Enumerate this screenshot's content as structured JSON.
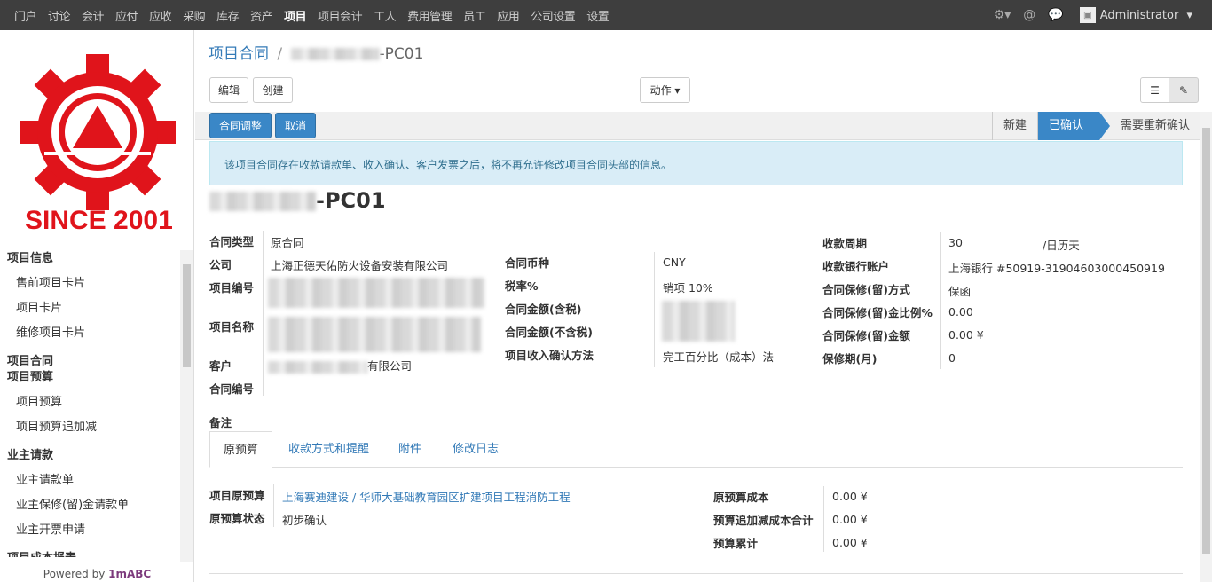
{
  "topmenu": [
    "门户",
    "讨论",
    "会计",
    "应付",
    "应收",
    "采购",
    "库存",
    "资产",
    "项目",
    "项目会计",
    "工人",
    "费用管理",
    "员工",
    "应用",
    "公司设置",
    "设置"
  ],
  "topmenu_active": "项目",
  "user": "Administrator",
  "logo_text": "SINCE 2001",
  "sidebar": {
    "sections": [
      {
        "title": "项目信息",
        "items": [
          "售前项目卡片",
          "项目卡片",
          "维修项目卡片"
        ]
      },
      {
        "title": "项目合同",
        "items": []
      },
      {
        "title": "项目预算",
        "items": [
          "项目预算",
          "项目预算追加减"
        ]
      },
      {
        "title": "业主请款",
        "items": [
          "业主请款单",
          "业主保修(留)金请款单",
          "业主开票申请"
        ]
      },
      {
        "title": "项目成本报表",
        "items": []
      }
    ],
    "powered_prefix": "Powered by ",
    "powered_brand": "1mABC"
  },
  "breadcrumb": {
    "parent": "项目合同",
    "separator": "/",
    "current_suffix": "-PC01"
  },
  "buttons": {
    "edit": "编辑",
    "create": "创建",
    "action": "动作",
    "adjust": "合同调整",
    "cancel": "取消"
  },
  "stages": [
    "新建",
    "已确认",
    "需要重新确认"
  ],
  "stage_active": "已确认",
  "alert": "该项目合同存在收款请款单、收入确认、客户发票之后，将不再允许修改项目合同头部的信息。",
  "record_title_suffix": "-PC01",
  "form": {
    "col1": {
      "contract_type_label": "合同类型",
      "contract_type": "原合同",
      "company_label": "公司",
      "company": "上海正德天佑防火设备安装有限公司",
      "project_no_label": "项目编号",
      "project_name_label": "项目名称",
      "customer_label": "客户",
      "customer_suffix": "有限公司",
      "contract_no_label": "合同编号"
    },
    "col2": {
      "currency_label": "合同币种",
      "currency": "CNY",
      "tax_label": "税率%",
      "tax": "销项 10%",
      "amount_tax_label": "合同金额(含税)",
      "amount_notax_label": "合同金额(不含税)",
      "method_label": "项目收入确认方法",
      "method": "完工百分比（成本）法"
    },
    "col3": {
      "period_label": "收款周期",
      "period": "30",
      "period_unit": "/日历天",
      "bank_label": "收款银行账户",
      "bank": "上海银行 #50919-31904603000450919",
      "retention_method_label": "合同保修(留)方式",
      "retention_method": "保函",
      "retention_ratio_label": "合同保修(留)金比例%",
      "retention_ratio": "0.00",
      "retention_amount_label": "合同保修(留)金额",
      "retention_amount": "0.00 ¥",
      "warranty_label": "保修期(月)",
      "warranty": "0"
    },
    "notes_label": "备注"
  },
  "tabs": [
    "原预算",
    "收款方式和提醒",
    "附件",
    "修改日志"
  ],
  "tab_active": "原预算",
  "budget": {
    "orig_label": "项目原预算",
    "orig": "上海赛迪建设 / 华师大基础教育园区扩建项目工程消防工程",
    "status_label": "原预算状态",
    "status": "初步确认",
    "cost_label": "原预算成本",
    "cost": "0.00 ¥",
    "add_label": "预算追加减成本合计",
    "add": "0.00 ¥",
    "total_label": "预算累计",
    "total": "0.00 ¥"
  },
  "colors": {
    "topbar": "#3e3e3e",
    "primary": "#3a87c7",
    "link": "#337ab7",
    "logo": "#e0141b",
    "alert_bg": "#d9edf7"
  }
}
